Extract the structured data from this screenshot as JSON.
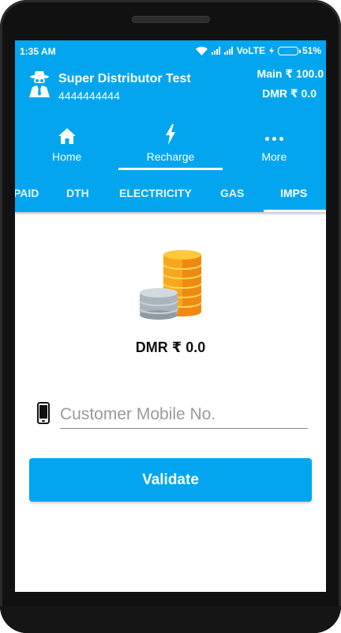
{
  "status_bar": {
    "time": "1:35 AM",
    "network": "VoLTE",
    "battery": "51%",
    "battery_level": 0.51
  },
  "header": {
    "user_name": "Super Distributor Test",
    "user_phone": "4444444444",
    "main_balance": "Main ₹ 100.0",
    "dmr_balance": "DMR ₹ 0.0"
  },
  "nav": {
    "items": [
      {
        "label": "Home",
        "icon": "home-icon"
      },
      {
        "label": "Recharge",
        "icon": "lightning-icon"
      },
      {
        "label": "More",
        "icon": "more-dots-icon"
      }
    ],
    "active": "Recharge"
  },
  "tabs": {
    "items": [
      "PAID",
      "DTH",
      "ELECTRICITY",
      "GAS",
      "IMPS"
    ],
    "active": "IMPS"
  },
  "content": {
    "icon": "coins-icon",
    "dmr_label": "DMR ₹ 0.0",
    "mobile_placeholder": "Customer Mobile No.",
    "mobile_value": "",
    "validate_label": "Validate"
  },
  "colors": {
    "accent": "#03a6ee",
    "battery": "#34e04a",
    "coin_gold": "#f7a71c",
    "coin_silver": "#a9b4bb"
  }
}
